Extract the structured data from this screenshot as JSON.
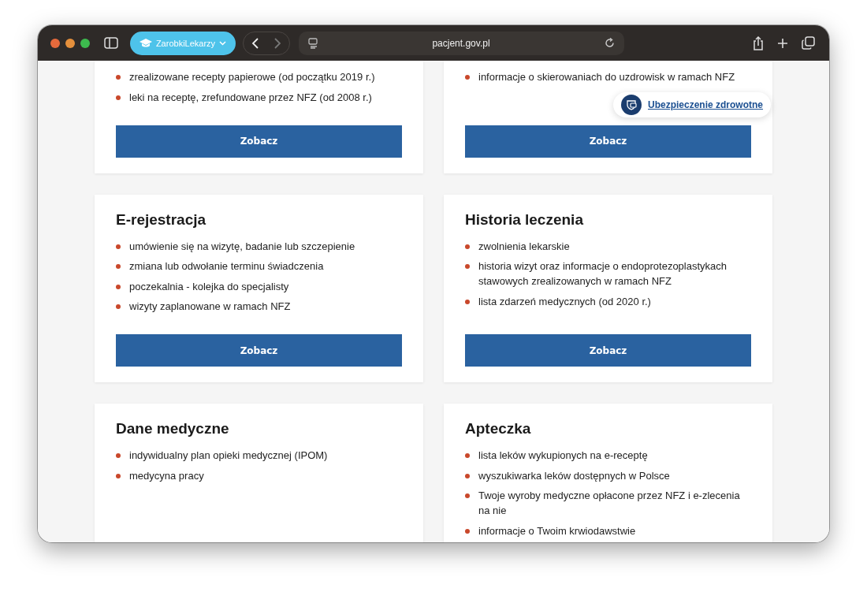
{
  "browser": {
    "tab_group": "ZarobkiLekarzy",
    "address": "pacjent.gov.pl"
  },
  "cards": [
    {
      "items": [
        "zrealizowane recepty papierowe (od początku 2019 r.)",
        "leki na receptę, zrefundowane przez NFZ (od 2008 r.)"
      ],
      "button": "Zobacz"
    },
    {
      "items": [
        "informacje o skierowaniach do uzdrowisk w ramach NFZ"
      ],
      "button": "Zobacz"
    },
    {
      "title": "E-rejestracja",
      "items": [
        "umówienie się na wizytę, badanie lub szczepienie",
        "zmiana lub odwołanie terminu świadczenia",
        "poczekalnia - kolejka do specjalisty",
        "wizyty zaplanowane w ramach NFZ"
      ],
      "button": "Zobacz"
    },
    {
      "title": "Historia leczenia",
      "items": [
        "zwolnienia lekarskie",
        "historia wizyt oraz informacje o endoprotezoplastykach stawowych zrealizowanych w ramach NFZ",
        "lista zdarzeń medycznych (od 2020 r.)"
      ],
      "button": "Zobacz"
    },
    {
      "title": "Dane medyczne",
      "items": [
        "indywidualny plan opieki medycznej (IPOM)",
        "medycyna pracy"
      ]
    },
    {
      "title": "Apteczka",
      "items": [
        "lista leków wykupionych na e-receptę",
        "wyszukiwarka leków dostępnych w Polsce",
        "Twoje wyroby medyczne opłacone przez NFZ i e-zlecenia na nie",
        "informacje o Twoim krwiodawstwie"
      ]
    }
  ],
  "floating_link": "Ubezpieczenie zdrowotne"
}
